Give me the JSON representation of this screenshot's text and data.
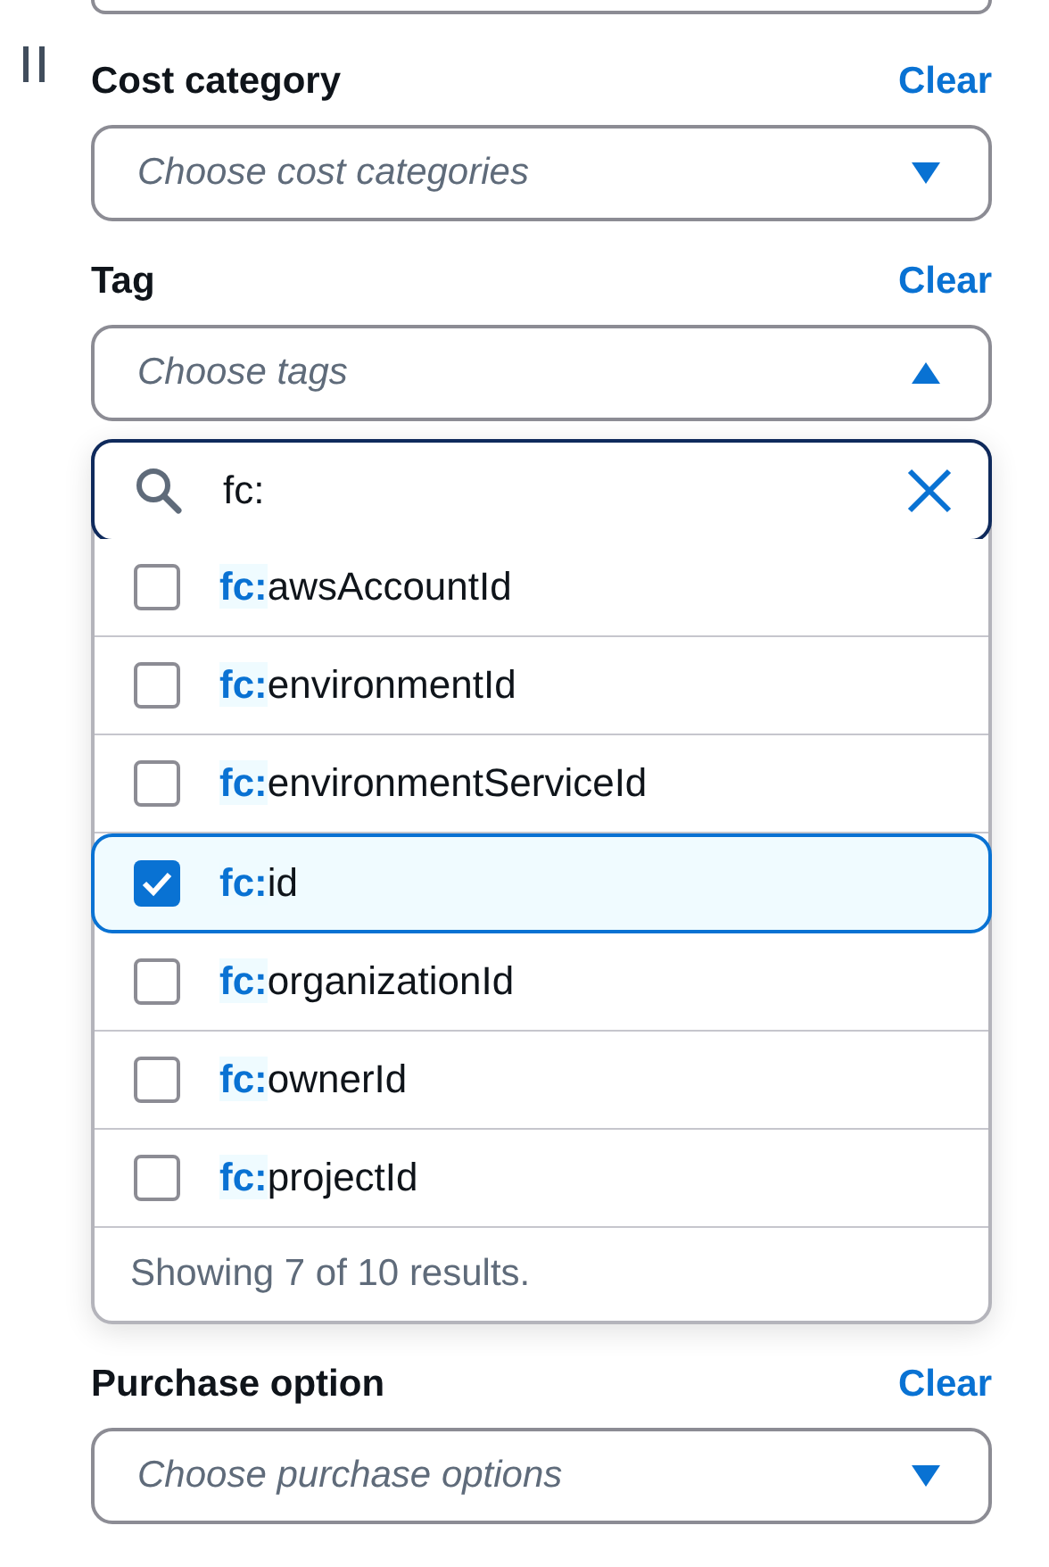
{
  "previous_field": {
    "kind": "select"
  },
  "filters": [
    {
      "label": "Cost category",
      "clear": "Clear",
      "placeholder": "Choose cost categories",
      "expanded": false
    },
    {
      "label": "Tag",
      "clear": "Clear",
      "placeholder": "Choose tags",
      "expanded": true,
      "dropdown": {
        "search": "fc:",
        "options": [
          {
            "match": "fc:",
            "rest": "awsAccountId",
            "checked": false
          },
          {
            "match": "fc:",
            "rest": "environmentId",
            "checked": false
          },
          {
            "match": "fc:",
            "rest": "environmentServiceId",
            "checked": false
          },
          {
            "match": "fc:",
            "rest": "id",
            "checked": true
          },
          {
            "match": "fc:",
            "rest": "organizationId",
            "checked": false
          },
          {
            "match": "fc:",
            "rest": "ownerId",
            "checked": false
          },
          {
            "match": "fc:",
            "rest": "projectId",
            "checked": false
          }
        ],
        "footer": "Showing 7 of 10 results."
      }
    },
    {
      "label": "Purchase option",
      "clear": "Clear",
      "placeholder": "Choose purchase options",
      "expanded": false
    }
  ]
}
